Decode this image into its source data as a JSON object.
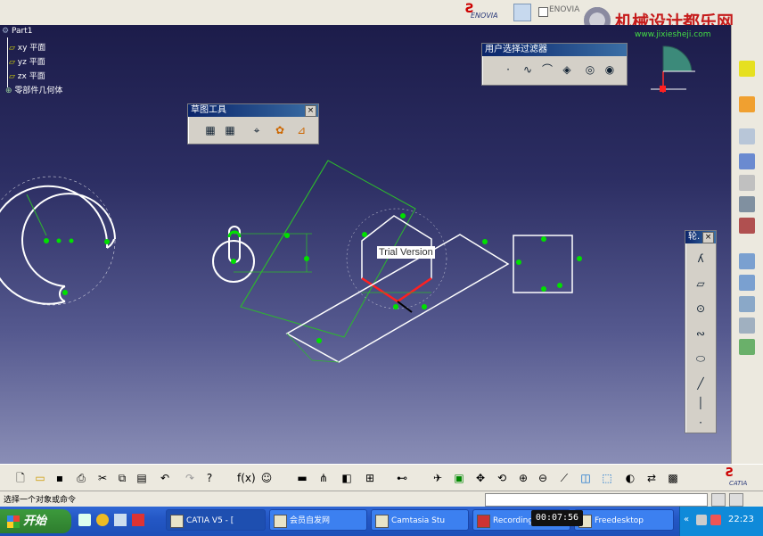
{
  "app": {
    "brand": "ENOVIA",
    "top_check_label": "ENOVIA",
    "watermark_title": "机械设计都乐网",
    "watermark_url": "www.jixiesheji.com"
  },
  "tree": {
    "root": "Part1",
    "items": [
      "xy 平面",
      "yz 平面",
      "zx 平面"
    ],
    "last": "零部件几何体"
  },
  "toolbars": {
    "filter_title": "用户选择过滤器",
    "sketch_tools_title": "草图工具",
    "profile_title": "轮."
  },
  "canvas": {
    "trial_label": "Trial Version"
  },
  "status": {
    "message": "选择一个对象或命令"
  },
  "taskbar": {
    "start": "开始",
    "items": [
      "CATIA V5 - [",
      "会员自发网",
      "Camtasia Stu",
      "Recording",
      "Freedesktop"
    ],
    "time": "22:23"
  },
  "video": {
    "timestamp": "00:07:56"
  },
  "logo": {
    "catia": "CATIA"
  },
  "colors": {
    "sketch_white": "#ffffff",
    "constraint_green": "#00e000",
    "construction_green": "#2db82d",
    "highlight_red": "#ff2020",
    "title_blue": "#0a246a"
  }
}
